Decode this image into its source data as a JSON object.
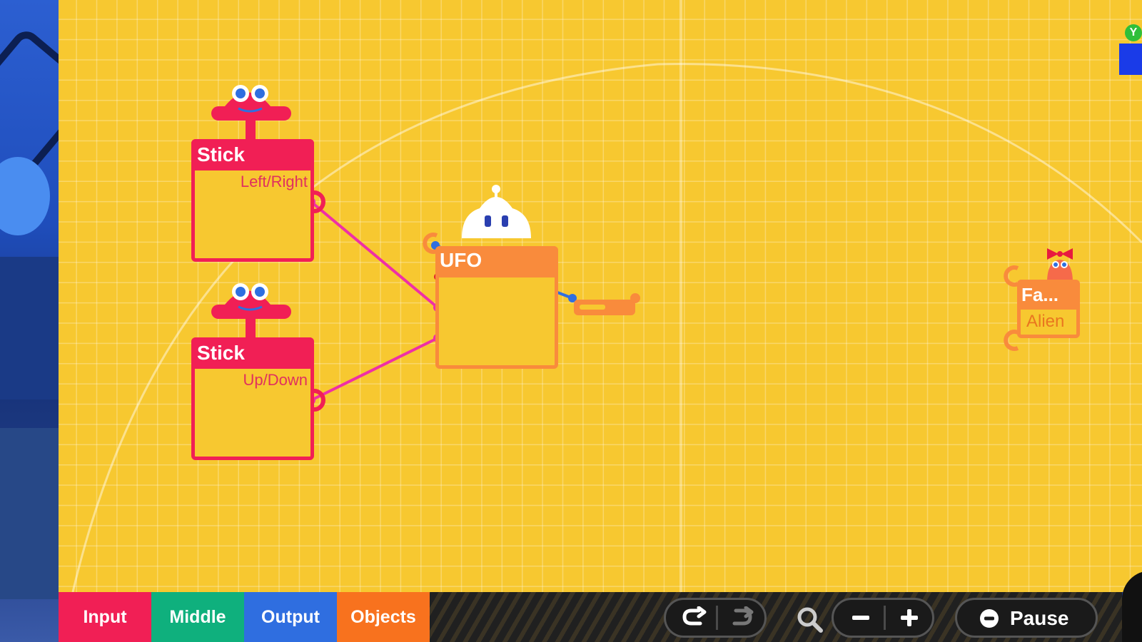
{
  "canvas": {
    "nodons": [
      {
        "kind": "stick",
        "title": "Stick",
        "setting": "Left/Right"
      },
      {
        "kind": "stick",
        "title": "Stick",
        "setting": "Up/Down"
      },
      {
        "kind": "object",
        "title": "UFO"
      },
      {
        "kind": "object",
        "title": "Fa...",
        "setting": "Alien"
      }
    ]
  },
  "bottom_bar": {
    "tabs": [
      {
        "label": "Input",
        "color": "#f11f55"
      },
      {
        "label": "Middle",
        "color": "#0fb07d"
      },
      {
        "label": "Output",
        "color": "#2f6ee0"
      },
      {
        "label": "Objects",
        "color": "#f8721e"
      }
    ],
    "pause_label": "Pause"
  },
  "corner_badge": "Y",
  "icons": [
    "undo-icon",
    "redo-icon",
    "search-icon",
    "zoom-out-icon",
    "zoom-in-icon",
    "minus-circle-icon"
  ],
  "colors": {
    "canvas": "#f7c830",
    "input_nodon": "#f11f55",
    "object_nodon": "#f98b3c",
    "wire_pink": "#ef2fa6",
    "wire_blue": "#2f6fe0"
  }
}
